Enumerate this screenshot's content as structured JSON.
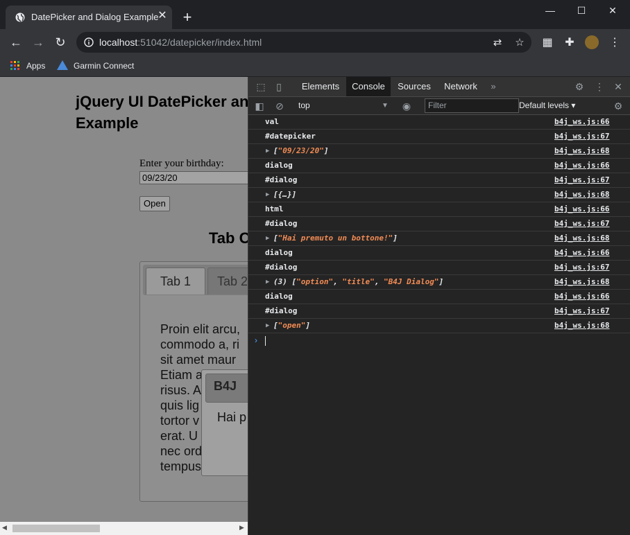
{
  "browser": {
    "tab_title": "DatePicker and Dialog Example",
    "tab_close": "✕",
    "new_tab": "+",
    "url_host": "localhost",
    "url_rest": ":51042/datepicker/index.html",
    "bookmarks": [
      {
        "label": "Apps",
        "icon": "apps-grid-icon"
      },
      {
        "label": "Garmin Connect",
        "icon": "garmin-icon"
      }
    ],
    "window_controls": {
      "minimize": "—",
      "maximize": "☐",
      "close": "✕"
    }
  },
  "page": {
    "heading": "jQuery UI DatePicker and Dialog Example",
    "heading_line1": "jQuery UI DatePicker an",
    "heading_line2": "Example",
    "birthday_label": "Enter your birthday:",
    "birthday_value": "09/23/20",
    "open_button": "Open",
    "tab_heading": "Tab C",
    "tabs": [
      "Tab 1",
      "Tab 2"
    ],
    "tab_content": "Proin elit arcu, commodo a, ri sit amet maur Etiam a risus. A quis lig tortor v erat. U nec ord tempus",
    "tab_content_lines": [
      "Proin elit arcu,",
      "commodo a, ri",
      "sit amet maur",
      "Etiam a",
      "risus. A",
      "quis lig",
      "tortor v",
      "erat. U",
      "nec ord",
      "tempus"
    ],
    "dialog_title": "B4J",
    "dialog_text": "Hai p"
  },
  "devtools": {
    "tabs": [
      "Elements",
      "Console",
      "Sources",
      "Network"
    ],
    "active_tab": "Console",
    "more_tabs": "»",
    "context": "top",
    "filter_placeholder": "Filter",
    "levels": "Default levels ▾",
    "console": [
      {
        "msg": "val",
        "src": "b4j_ws.js:66",
        "kind": "text"
      },
      {
        "msg": "#datepicker",
        "src": "b4j_ws.js:67",
        "kind": "text"
      },
      {
        "prefix": "[",
        "strings": [
          "\"09/23/20\""
        ],
        "suffix": "]",
        "src": "b4j_ws.js:68",
        "kind": "array"
      },
      {
        "msg": "dialog",
        "src": "b4j_ws.js:66",
        "kind": "text"
      },
      {
        "msg": "#dialog",
        "src": "b4j_ws.js:67",
        "kind": "text"
      },
      {
        "prefix": "[{…}]",
        "strings": [],
        "suffix": "",
        "src": "b4j_ws.js:68",
        "kind": "array"
      },
      {
        "msg": "html",
        "src": "b4j_ws.js:66",
        "kind": "text"
      },
      {
        "msg": "#dialog",
        "src": "b4j_ws.js:67",
        "kind": "text"
      },
      {
        "prefix": "[",
        "strings": [
          "\"Hai premuto un bottone!\""
        ],
        "suffix": "]",
        "src": "b4j_ws.js:68",
        "kind": "array"
      },
      {
        "msg": "dialog",
        "src": "b4j_ws.js:66",
        "kind": "text"
      },
      {
        "msg": "#dialog",
        "src": "b4j_ws.js:67",
        "kind": "text"
      },
      {
        "prefix": "(3) [",
        "strings": [
          "\"option\"",
          "\"title\"",
          "\"B4J Dialog\""
        ],
        "suffix": "]",
        "src": "b4j_ws.js:68",
        "kind": "array"
      },
      {
        "msg": "dialog",
        "src": "b4j_ws.js:66",
        "kind": "text"
      },
      {
        "msg": "#dialog",
        "src": "b4j_ws.js:67",
        "kind": "text"
      },
      {
        "prefix": "[",
        "strings": [
          "\"open\""
        ],
        "suffix": "]",
        "src": "b4j_ws.js:68",
        "kind": "array"
      }
    ],
    "prompt": "›"
  },
  "colors": {
    "string": "#f28b54",
    "prompt": "#4aa3ff",
    "chrome_dark": "#202124",
    "toolbar": "#35363a"
  }
}
